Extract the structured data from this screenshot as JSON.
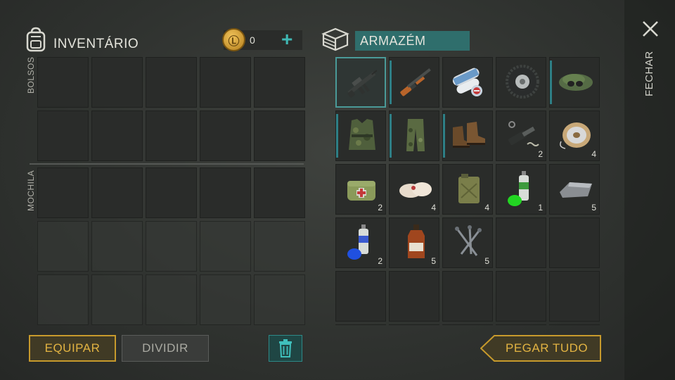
{
  "inventory": {
    "title": "INVENTÁRIO",
    "coins": "0",
    "pockets_label": "BOLSOS",
    "backpack_label": "MOCHILA"
  },
  "storage": {
    "title": "ARMAZÉM",
    "items": [
      {
        "icon": "assault-rifle-icon",
        "count": "",
        "selected": true,
        "mark": false
      },
      {
        "icon": "shotgun-icon",
        "count": "",
        "selected": false,
        "mark": true
      },
      {
        "icon": "blueprint-scrolls-icon",
        "count": "",
        "selected": false,
        "mark": false
      },
      {
        "icon": "tire-icon",
        "count": "",
        "selected": false,
        "mark": false
      },
      {
        "icon": "military-beret-icon",
        "count": "",
        "selected": false,
        "mark": true
      },
      {
        "icon": "camo-vest-icon",
        "count": "",
        "selected": false,
        "mark": true
      },
      {
        "icon": "camo-pants-icon",
        "count": "",
        "selected": false,
        "mark": true
      },
      {
        "icon": "boots-icon",
        "count": "",
        "selected": false,
        "mark": true
      },
      {
        "icon": "weapon-parts-icon",
        "count": "2",
        "selected": false,
        "mark": false
      },
      {
        "icon": "wire-spool-icon",
        "count": "4",
        "selected": false,
        "mark": false
      },
      {
        "icon": "medkit-bag-icon",
        "count": "2",
        "selected": false,
        "mark": false
      },
      {
        "icon": "bandage-icon",
        "count": "4",
        "selected": false,
        "mark": false
      },
      {
        "icon": "jerrycan-icon",
        "count": "4",
        "selected": false,
        "mark": false
      },
      {
        "icon": "green-spray-paint-icon",
        "count": "1",
        "selected": false,
        "mark": false
      },
      {
        "icon": "metal-ingot-icon",
        "count": "5",
        "selected": false,
        "mark": false
      },
      {
        "icon": "blue-spray-paint-icon",
        "count": "2",
        "selected": false,
        "mark": false
      },
      {
        "icon": "medicine-bottle-icon",
        "count": "5",
        "selected": false,
        "mark": false
      },
      {
        "icon": "nails-icon",
        "count": "5",
        "selected": false,
        "mark": false
      }
    ]
  },
  "close_label": "FECHAR",
  "buttons": {
    "equip": "EQUIPAR",
    "split": "DIVIDIR",
    "take_all": "PEGAR TUDO"
  },
  "colors": {
    "accent_teal": "#2e7f86",
    "accent_gold": "#c79a2c",
    "storage_header": "#2f6e6c"
  }
}
